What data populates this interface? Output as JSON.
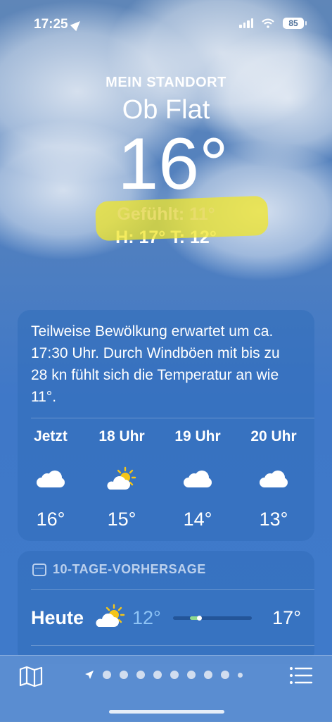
{
  "status": {
    "time": "17:25",
    "battery": "85"
  },
  "header": {
    "location_label": "MEIN STANDORT",
    "city": "Ob Flat",
    "temperature": "16°",
    "feels_like": "Gefühlt: 11°",
    "high_low": "H: 17°  T: 12°"
  },
  "hourly": {
    "summary": "Teilweise Bewölkung erwartet um ca. 17:30 Uhr. Durch Windböen mit bis zu 28 kn fühlt sich die Temperatur an wie 11°.",
    "hours": [
      {
        "label": "Jetzt",
        "icon": "cloud-icon",
        "temp": "16°"
      },
      {
        "label": "18 Uhr",
        "icon": "partly-sunny-icon",
        "temp": "15°"
      },
      {
        "label": "19 Uhr",
        "icon": "cloud-icon",
        "temp": "14°"
      },
      {
        "label": "20 Uhr",
        "icon": "cloud-icon",
        "temp": "13°"
      }
    ]
  },
  "forecast": {
    "title": "10-TAGE-VORHERSAGE",
    "days": [
      {
        "name": "Heute",
        "icon": "partly-sunny-icon",
        "low": "12°",
        "high": "17°",
        "current_position": 0.3
      }
    ]
  },
  "colors": {
    "feels_highlight": "#f0e628",
    "low_temp": "#8ec3f5",
    "range_bar": "#8fd98f"
  }
}
